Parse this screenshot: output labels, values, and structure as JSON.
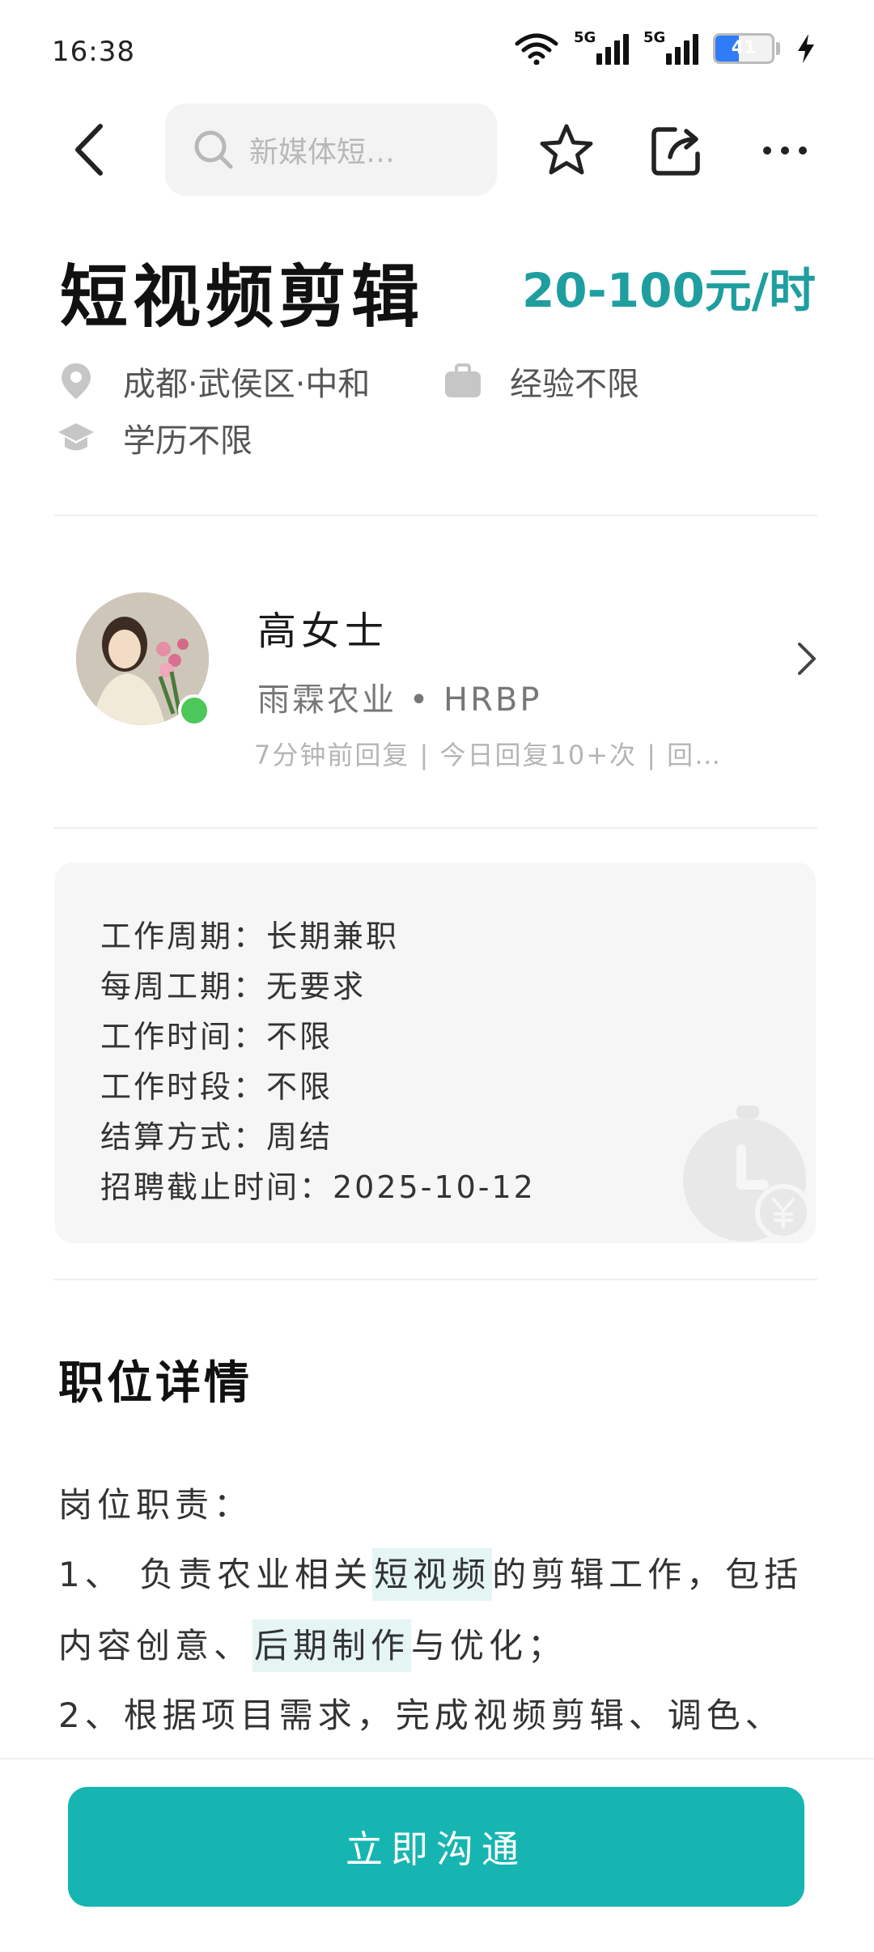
{
  "status_bar": {
    "time": "16:38",
    "network_1": "5G",
    "network_2": "5G",
    "battery_level": "41",
    "battery_percent": 41,
    "icons": [
      "wifi-icon",
      "signal-icon",
      "signal-icon",
      "battery-icon",
      "charging-icon"
    ]
  },
  "nav": {
    "search_placeholder": "新媒体短…",
    "icons": [
      "back-icon",
      "search-icon",
      "star-icon",
      "share-icon",
      "more-icon"
    ]
  },
  "job": {
    "title": "短视频剪辑",
    "salary": "20-100元/时",
    "salary_color": "#1f9ea0",
    "location": "成都·武侯区·中和",
    "experience": "经验不限",
    "education": "学历不限"
  },
  "recruiter": {
    "name": "高女士",
    "company_role": "雨霖农业 • HRBP",
    "reply_info": "7分钟前回复 | 今日回复10+次 | 回…",
    "online_color": "#4cc85a"
  },
  "info_card": {
    "items": [
      "工作周期：长期兼职",
      "每周工期：无要求",
      "工作时间：不限",
      "工作时段：不限",
      "结算方式：周结",
      "招聘截止时间：2025-10-12"
    ]
  },
  "details": {
    "section_title": "职位详情",
    "heading": "岗位职责：",
    "line1_pre": "1、 负责农业相关",
    "line1_hl": "短视频",
    "line1_post": "的剪辑工作，包括",
    "line2_pre": "内容创意、",
    "line2_hl": "后期制作",
    "line2_post": "与优化；",
    "line3": "2、根据项目需求，完成视频剪辑、调色、"
  },
  "bottom": {
    "cta_label": "立即沟通",
    "cta_color": "#16b5b2"
  }
}
